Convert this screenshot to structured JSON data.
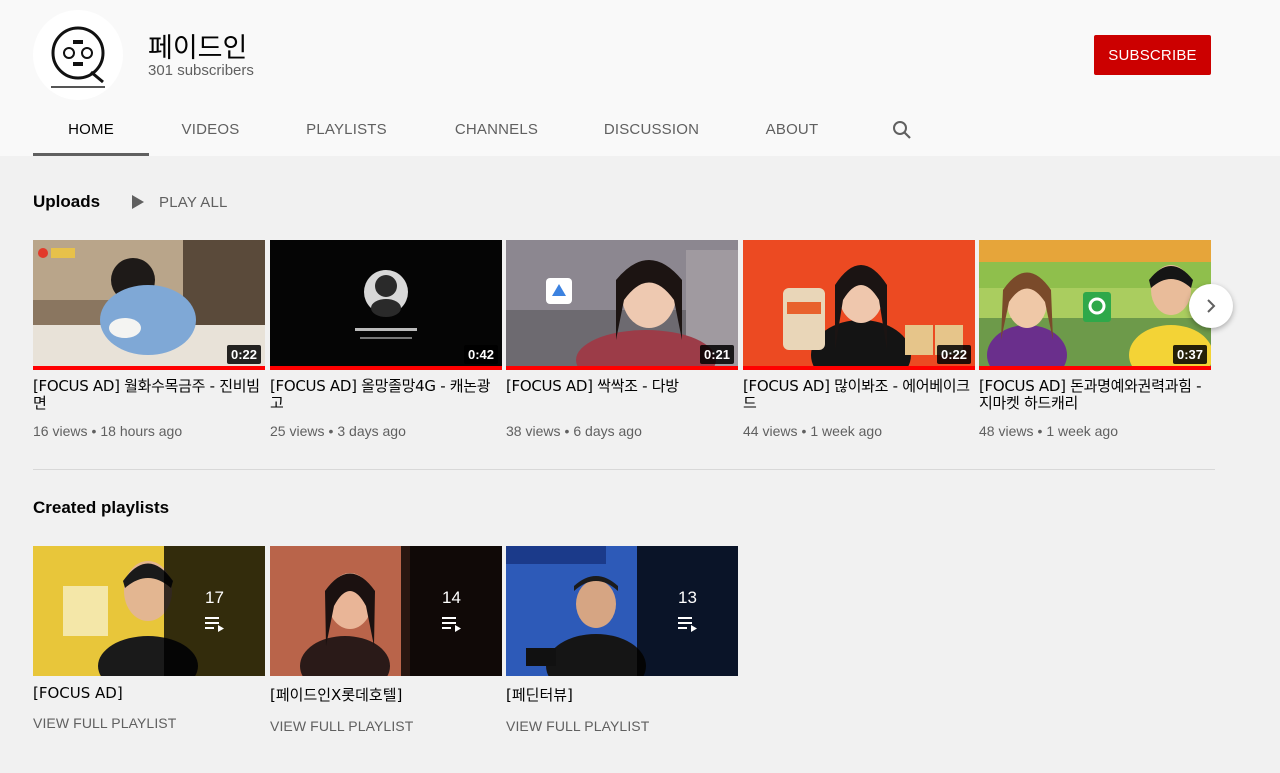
{
  "channel": {
    "name": "페이드인",
    "subscribers": "301 subscribers",
    "subscribe_label": "SUBSCRIBE",
    "accent_color": "#cc0000"
  },
  "tabs": [
    {
      "label": "HOME",
      "active": true
    },
    {
      "label": "VIDEOS"
    },
    {
      "label": "PLAYLISTS"
    },
    {
      "label": "CHANNELS"
    },
    {
      "label": "DISCUSSION"
    },
    {
      "label": "ABOUT"
    }
  ],
  "search_icon": "search-icon",
  "uploads": {
    "title": "Uploads",
    "play_all": "PLAY ALL",
    "videos": [
      {
        "title": "[FOCUS AD] 월화수목금주 - 진비빔면",
        "duration": "0:22",
        "views": "16 views",
        "age": "18 hours ago"
      },
      {
        "title": "[FOCUS AD] 올망졸망4G - 캐논광고",
        "duration": "0:42",
        "views": "25 views",
        "age": "3 days ago"
      },
      {
        "title": "[FOCUS AD] 싹싹조 - 다방",
        "duration": "0:21",
        "views": "38 views",
        "age": "6 days ago"
      },
      {
        "title": "[FOCUS AD] 많이봐조 - 에어베이크드",
        "duration": "0:22",
        "views": "44 views",
        "age": "1 week ago"
      },
      {
        "title": "[FOCUS AD] 돈과명예와권력과힘 - 지마켓 하드캐리",
        "duration": "0:37",
        "views": "48 views",
        "age": "1 week ago"
      }
    ]
  },
  "playlists": {
    "title": "Created playlists",
    "items": [
      {
        "title": "[FOCUS AD]",
        "count": "17",
        "link": "VIEW FULL PLAYLIST"
      },
      {
        "title": "[페이드인X롯데호텔]",
        "count": "14",
        "link": "VIEW FULL PLAYLIST"
      },
      {
        "title": "[페딘터뷰]",
        "count": "13",
        "link": "VIEW FULL PLAYLIST"
      }
    ]
  }
}
